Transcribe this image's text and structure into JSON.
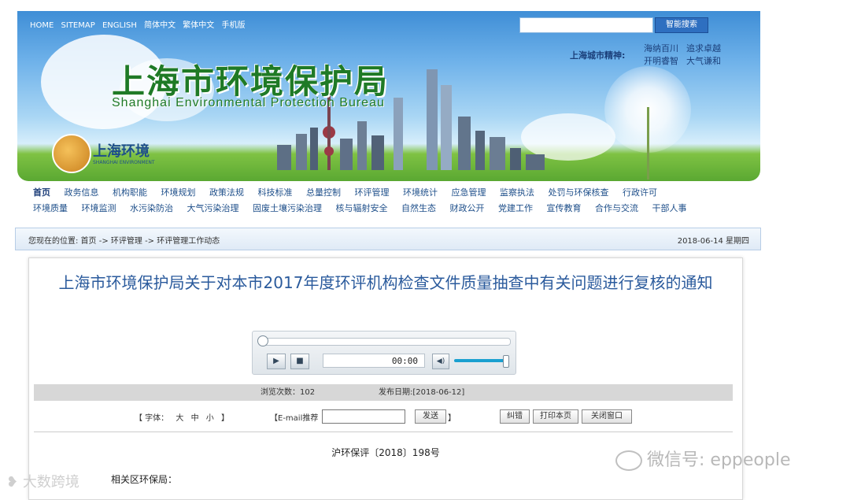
{
  "topnav": [
    "HOME",
    "SITEMAP",
    "ENGLISH",
    "简体中文",
    "繁体中文",
    "手机版"
  ],
  "search": {
    "placeholder": "",
    "button": "智能搜索"
  },
  "brand": {
    "title_zh": "上海市环境保护局",
    "title_en": "Shanghai Environmental Protection Bureau",
    "logo_zh": "上海环境",
    "logo_en": "SHANGHAI ENVIRONMENT"
  },
  "city_spirit": {
    "label": "上海城市精神:",
    "row1": [
      "海纳百川",
      "追求卓越"
    ],
    "row2": [
      "开明睿智",
      "大气谦和"
    ]
  },
  "nav": {
    "row1": [
      "首页",
      "政务信息",
      "机构职能",
      "环境规划",
      "政策法规",
      "科技标准",
      "总量控制",
      "环评管理",
      "环境统计",
      "应急管理",
      "监察执法",
      "处罚与环保核查",
      "行政许可"
    ],
    "row2": [
      "环境质量",
      "环境监测",
      "水污染防治",
      "大气污染治理",
      "固废土壤污染治理",
      "核与辐射安全",
      "自然生态",
      "财政公开",
      "党建工作",
      "宣传教育",
      "合作与交流",
      "干部人事"
    ]
  },
  "breadcrumb": {
    "text": "您现在的位置:  首页 -> 环评管理 -> 环评管理工作动态",
    "date": "2018-06-14  星期四"
  },
  "article": {
    "title": "上海市环境保护局关于对本市2017年度环评机构检查文件质量抽查中有关问题进行复核的通知",
    "views": "浏览次数：102",
    "publish_date": "发布日期:[2018-06-12]",
    "doc_no": "沪环保评〔2018〕198号",
    "addressee": "相关区环保局："
  },
  "player": {
    "time": "00:00",
    "play_icon": "play-icon",
    "stop_icon": "stop-icon",
    "progress": 0,
    "volume": 1.0
  },
  "tools": {
    "font_prefix": "【 字体：",
    "font_large": "大",
    "font_medium": "中",
    "font_small": "小",
    "font_suffix": "】",
    "email_label": "【E-mail推荐",
    "send": "发送",
    "bracket_end": "】",
    "correct": "纠错",
    "print": "打印本页",
    "close": "关闭窗口"
  },
  "watermarks": {
    "right": "微信号: eppeople",
    "left": "大数跨境"
  }
}
